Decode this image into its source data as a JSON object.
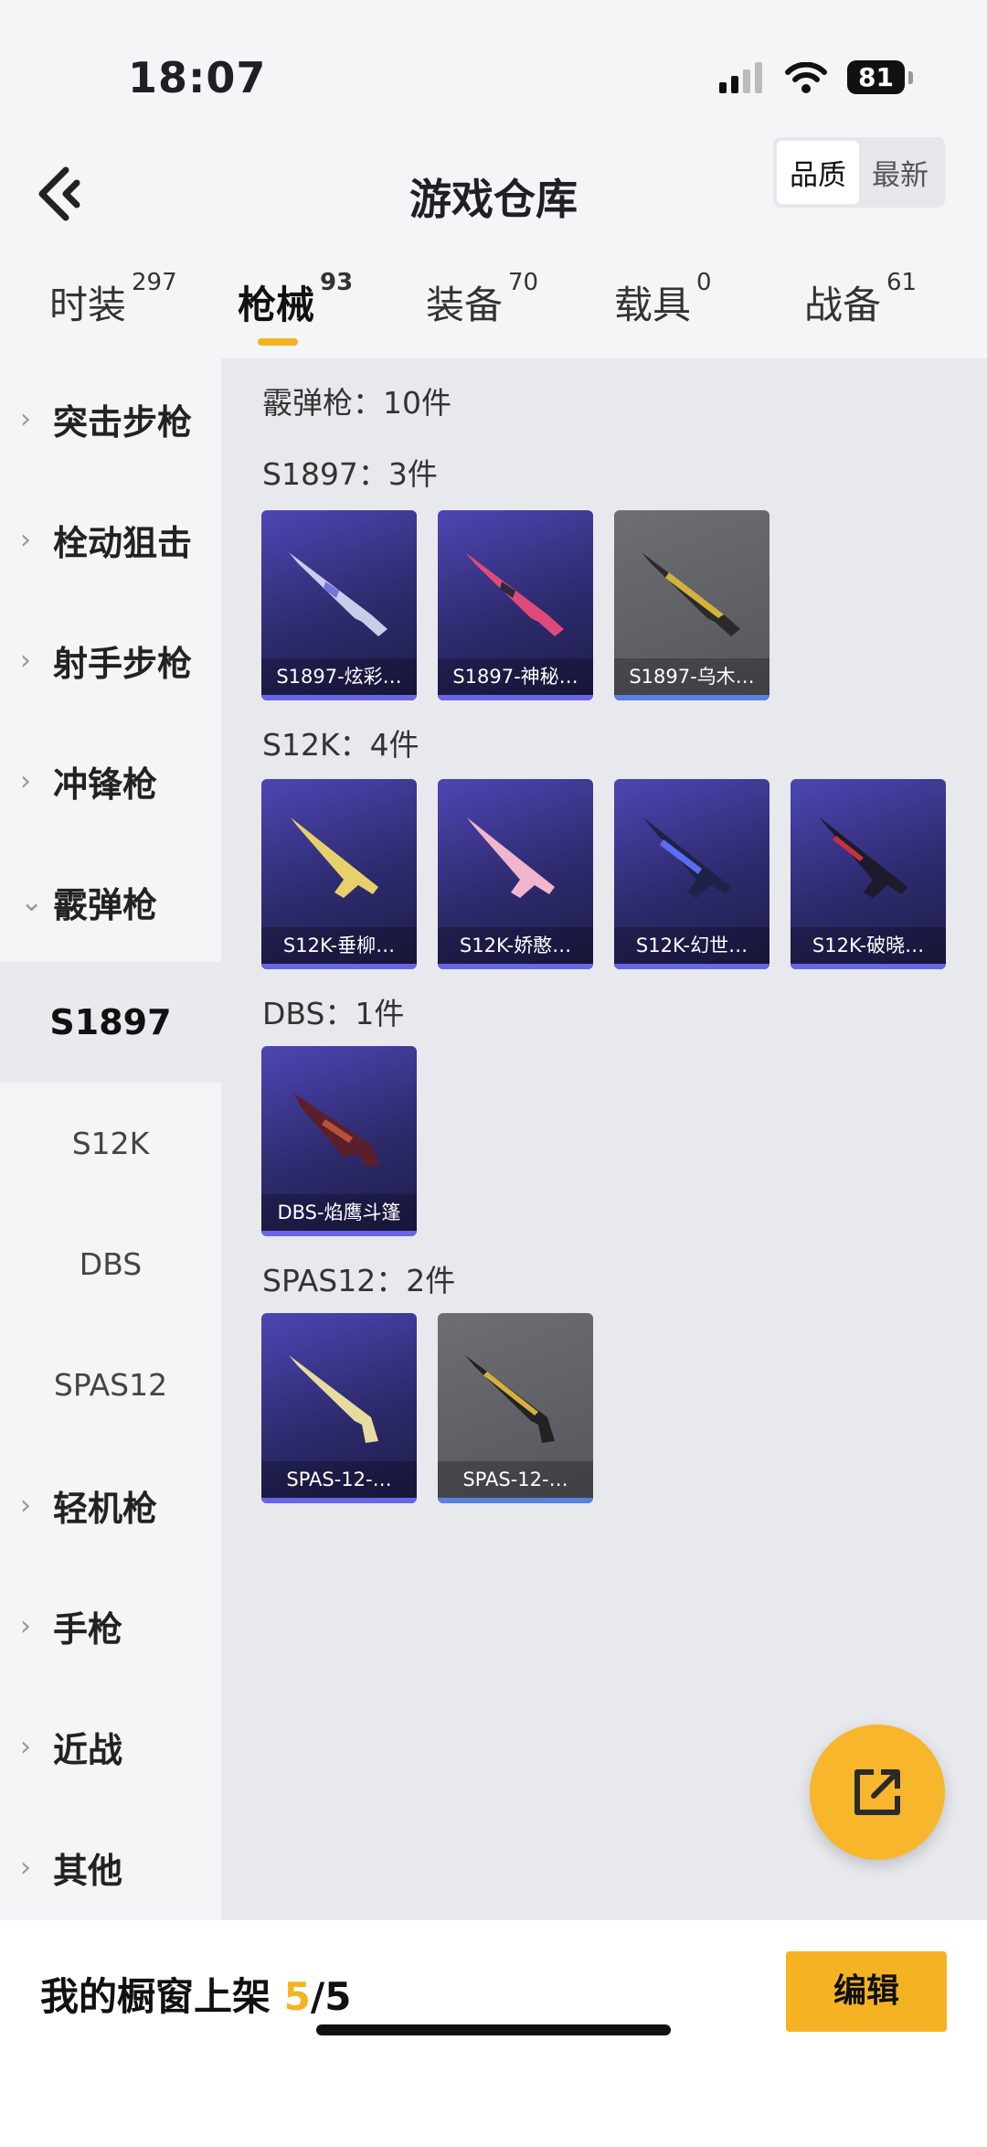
{
  "status": {
    "time": "18:07",
    "battery": "81"
  },
  "header": {
    "title": "游戏仓库",
    "sort": [
      "品质",
      "最新"
    ]
  },
  "tabs": [
    {
      "label": "时装",
      "count": "297"
    },
    {
      "label": "枪械",
      "count": "93"
    },
    {
      "label": "装备",
      "count": "70"
    },
    {
      "label": "载具",
      "count": "0"
    },
    {
      "label": "战备",
      "count": "61"
    }
  ],
  "sidebar": {
    "categories": [
      "突击步枪",
      "栓动狙击",
      "射手步枪",
      "冲锋枪",
      "霰弹枪"
    ],
    "subcategories": [
      "S1897",
      "S12K",
      "DBS",
      "SPAS12"
    ],
    "categories_after": [
      "轻机枪",
      "手枪",
      "近战",
      "其他"
    ]
  },
  "content": {
    "summary": "霰弹枪：10件",
    "groups": [
      {
        "label": "S1897：3件",
        "items": [
          "S1897-炫彩…",
          "S1897-神秘…",
          "S1897-乌木…"
        ]
      },
      {
        "label": "S12K：4件",
        "items": [
          "S12K-垂柳…",
          "S12K-娇憨…",
          "S12K-幻世…",
          "S12K-破晓…"
        ]
      },
      {
        "label": "DBS：1件",
        "items": [
          "DBS-焰鹰斗篷"
        ]
      },
      {
        "label": "SPAS12：2件",
        "items": [
          "SPAS-12-…",
          "SPAS-12-…"
        ]
      }
    ]
  },
  "bottom": {
    "showcase_label": "我的橱窗上架",
    "showcase_used": "5",
    "showcase_total": "/5",
    "edit_label": "编辑"
  },
  "colors": {
    "accent": "#f5b324",
    "card_purple": "#3a357f",
    "card_grey": "#606166"
  }
}
